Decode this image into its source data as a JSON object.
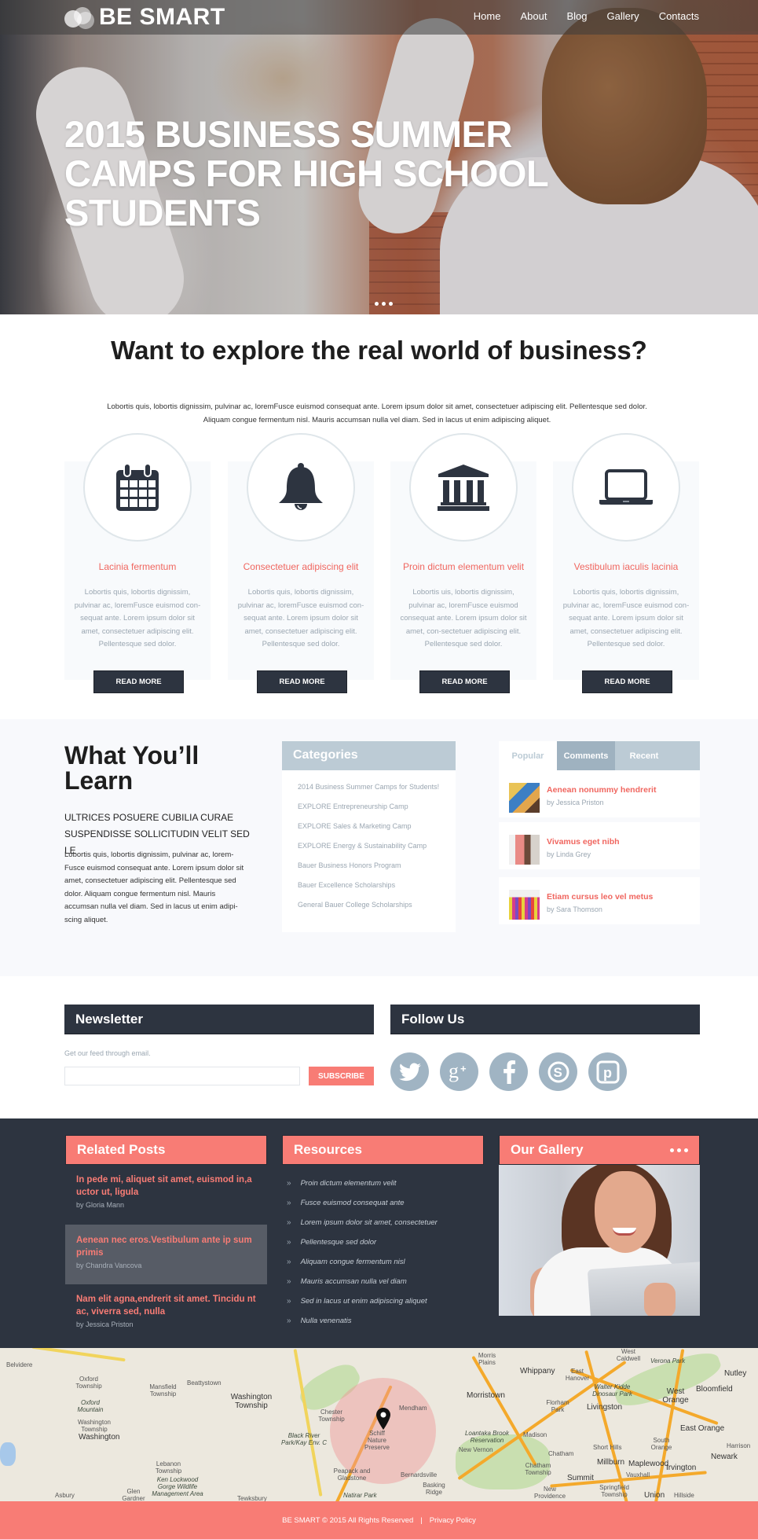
{
  "brand": {
    "name": "BE SMART"
  },
  "nav": {
    "items": [
      "Home",
      "About",
      "Blog",
      "Gallery",
      "Contacts"
    ]
  },
  "hero": {
    "title": "2015 BUSINESS SUMMER CAMPS FOR HIGH SCHOOL STUDENTS",
    "slide_count": 3
  },
  "intro": {
    "title": "Want to explore the real world of business?",
    "text": "Lobortis quis, lobortis dignissim, pulvinar ac, loremFusce euismod consequat ante. Lorem ipsum dolor sit amet, consectetuer adipiscing elit. Pellentesque sed dolor. Aliquam congue fermentum nisl. Mauris accumsan nulla vel diam. Sed in lacus ut enim adipiscing aliquet."
  },
  "features": [
    {
      "icon": "calendar-icon",
      "title": "Lacinia fermentum",
      "text": "Lobortis quis, lobortis dignissim, pulvinar ac, loremFusce euismod con-sequat ante. Lorem ipsum dolor sit amet, consectetuer adipiscing elit. Pellentesque sed dolor.",
      "button": "READ MORE"
    },
    {
      "icon": "bell-icon",
      "title": "Consectetuer adipiscing elit",
      "text": "Lobortis quis, lobortis dignissim, pulvinar ac, loremFusce euismod con-sequat ante. Lorem ipsum dolor sit amet, consectetuer adipiscing elit. Pellentesque sed dolor.",
      "button": "READ MORE"
    },
    {
      "icon": "bank-icon",
      "title": "Proin dictum elementum velit",
      "text": "Lobortis uis, lobortis dignissim, pulvinar ac, loremFusce euismod consequat ante. Lorem ipsum dolor sit amet, con-sectetuer adipiscing elit. Pellentesque sed dolor.",
      "button": "READ MORE"
    },
    {
      "icon": "laptop-icon",
      "title": "Vestibulum iaculis lacinia",
      "text": "Lobortis quis, lobortis dignissim, pulvinar ac, loremFusce euismod con-sequat ante. Lorem ipsum dolor sit amet, consectetuer adipiscing elit. Pellentesque sed dolor.",
      "button": "READ MORE"
    }
  ],
  "learn": {
    "title": "What You’ll Learn",
    "subtitle": "ULTRICES POSUERE CUBILIA CURAE SUSPENDISSE SOLLICITUDIN VELIT SED LE",
    "text": "Lobortis quis, lobortis dignissim, pulvinar ac, lorem-Fusce euismod consequat ante. Lorem ipsum dolor sit amet, consectetuer adipiscing elit. Pellentesque sed dolor. Aliquam congue fermentum nisl. Mauris accumsan nulla vel diam. Sed in lacus ut enim adipi-scing aliquet."
  },
  "categories": {
    "title": "Categories",
    "items": [
      "2014 Business Summer Camps for Students!",
      "EXPLORE Entrepreneurship Camp",
      "EXPLORE Sales & Marketing Camp",
      "EXPLORE Energy & Sustainability Camp",
      "Bauer Business Honors Program",
      "Bauer Excellence Scholarships",
      "General Bauer College Scholarships"
    ]
  },
  "tabs": {
    "labels": [
      "Popular",
      "Comments",
      "Recent"
    ],
    "active": "Popular",
    "posts": [
      {
        "title": "Aenean nonummy hendrerit",
        "author": "by Jessica Priston"
      },
      {
        "title": "Vivamus eget nibh",
        "author": "by Linda Grey"
      },
      {
        "title": "Etiam cursus leo vel metus",
        "author": "by Sara Thomson"
      }
    ]
  },
  "newsletter": {
    "title": "Newsletter",
    "label": "Get our feed through email.",
    "input_value": "",
    "input_placeholder": "",
    "button": "SUBSCRIBE"
  },
  "follow": {
    "title": "Follow Us",
    "networks": [
      "twitter-icon",
      "google-plus-icon",
      "facebook-icon",
      "skype-icon",
      "pinterest-icon"
    ]
  },
  "related_posts": {
    "title": "Related Posts",
    "items": [
      {
        "title": "In pede mi, aliquet sit amet, euismod in,a uctor ut, ligula",
        "author": "by Gloria Mann",
        "highlighted": false
      },
      {
        "title": "Aenean nec eros.Vestibulum ante ip sum primis",
        "author": "by Chandra Vancova",
        "highlighted": true
      },
      {
        "title": "Nam elit agna,endrerit sit amet. Tincidu nt ac, viverra sed, nulla",
        "author": "by Jessica Priston",
        "highlighted": false
      }
    ]
  },
  "resources": {
    "title": "Resources",
    "items": [
      "Proin dictum elementum velit",
      "Fusce euismod consequat ante",
      "Lorem ipsum dolor sit amet, consectetuer",
      "Pellentesque sed dolor",
      "Aliquam congue fermentum nisl",
      "Mauris accumsan nulla vel diam",
      "Sed in lacus ut enim adipiscing aliquet",
      "Nulla venenatis"
    ]
  },
  "gallery": {
    "title": "Our Gallery"
  },
  "map": {
    "marker_label": "Schiff Nature Preserve",
    "labels": [
      "Belvidere",
      "Oxford Township",
      "Oxford Mountain",
      "Washington Township",
      "Washington",
      "Mansfield Township",
      "Beattystown",
      "Washington Township",
      "Lebanon Township",
      "Ken Lockwood Gorge Wildlife Management Area",
      "Asbury",
      "Glen Gardner",
      "Tewksbury",
      "Chester Township",
      "Black River Park/Kay Env. C",
      "Peapack and Gladstone",
      "Natirar Park",
      "Mendham",
      "Bernardsville",
      "Basking Ridge",
      "Morris Plains",
      "Morristown",
      "Whippany",
      "East Hanover",
      "Florham Park",
      "Livingston",
      "Madison",
      "Loantaka Brook Reservation",
      "New Vernon",
      "Chatham",
      "Chatham Township",
      "Short Hills",
      "Millburn",
      "Summit",
      "Springfield Township",
      "New Providence",
      "West Caldwell",
      "Verona Park",
      "Walter Kidde Dinosaur Park",
      "West Orange",
      "South Orange",
      "Maplewood",
      "Irvington",
      "Union",
      "Hillside",
      "Vauxhall",
      "Nutley",
      "Bloomfield",
      "East Orange",
      "Newark",
      "Harrison"
    ]
  },
  "footer": {
    "copyright": "BE SMART © 2015 All Rights Reserved",
    "separator": "|",
    "privacy": "Privacy Policy"
  },
  "colors": {
    "accent": "#f87c75",
    "dark": "#2d3440",
    "muted": "#bccbd5",
    "light_bg": "#f8f9fc"
  }
}
